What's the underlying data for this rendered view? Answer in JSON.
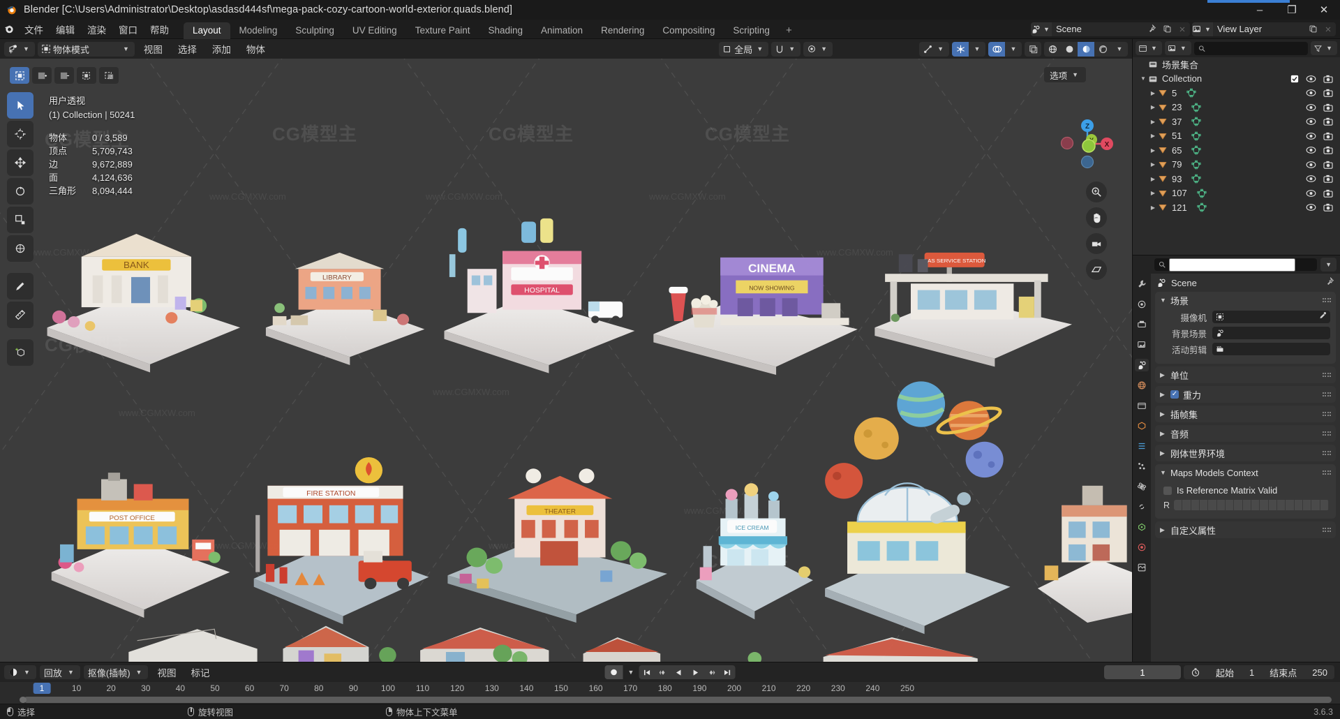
{
  "titlebar": {
    "title": "Blender [C:\\Users\\Administrator\\Desktop\\asdasd444sf\\mega-pack-cozy-cartoon-world-exterior.quads.blend]",
    "minimize": "–",
    "maximize": "❐",
    "close": "✕"
  },
  "topbar": {
    "menus": [
      "文件",
      "编辑",
      "渲染",
      "窗口",
      "帮助"
    ],
    "workspaces": [
      "Layout",
      "Modeling",
      "Sculpting",
      "UV Editing",
      "Texture Paint",
      "Shading",
      "Animation",
      "Rendering",
      "Compositing",
      "Scripting"
    ],
    "active_workspace": "Layout",
    "add_workspace": "+",
    "scene_name": "Scene",
    "view_layer_name": "View Layer"
  },
  "viewport": {
    "mode": "物体模式",
    "menus": [
      "视图",
      "选择",
      "添加",
      "物体"
    ],
    "transform_orientation": "全局",
    "options_label": "选项",
    "stats": {
      "view_name": "用户透视",
      "collection_line": "(1) Collection | 50241",
      "rows": [
        {
          "key": "物体",
          "value": "0 / 3,589"
        },
        {
          "key": "顶点",
          "value": "5,709,743"
        },
        {
          "key": "边",
          "value": "9,672,889"
        },
        {
          "key": "面",
          "value": "4,124,636"
        },
        {
          "key": "三角形",
          "value": "8,094,444"
        }
      ]
    },
    "gizmo_axes": [
      "Z",
      "Y",
      "X"
    ],
    "watermark_text": "www.CGMXW.com",
    "watermark_logo": "CG模型主"
  },
  "outliner": {
    "display_mode_icon": "view-layer-icon",
    "filter_icon": "filter-icon",
    "search_placeholder": "",
    "scene_collection_label": "场景集合",
    "collection_label": "Collection",
    "items": [
      {
        "name": "5"
      },
      {
        "name": "23"
      },
      {
        "name": "37"
      },
      {
        "name": "51"
      },
      {
        "name": "65"
      },
      {
        "name": "79"
      },
      {
        "name": "93"
      },
      {
        "name": "107"
      },
      {
        "name": "121"
      }
    ]
  },
  "properties": {
    "breadcrumb": "Scene",
    "search_placeholder": "",
    "tabs": [
      "tool-icon",
      "render-icon",
      "output-icon",
      "view-layer-icon",
      "scene-icon",
      "world-icon",
      "collection-icon",
      "object-icon",
      "modifier-icon",
      "particles-icon",
      "physics-icon",
      "constraint-icon",
      "data-icon",
      "material-icon",
      "texture-icon"
    ],
    "active_tab_index": 4,
    "panels": [
      {
        "label": "场景",
        "open": true,
        "rows": [
          {
            "label": "摄像机",
            "value": "",
            "icon": "camera-icon",
            "eyedropper": true
          },
          {
            "label": "背景场景",
            "value": "",
            "icon": "scene-icon",
            "eyedropper": false
          },
          {
            "label": "活动剪辑",
            "value": "",
            "icon": "clip-icon",
            "eyedropper": false
          }
        ]
      },
      {
        "label": "单位",
        "open": false,
        "rows": []
      },
      {
        "label": "重力",
        "open": false,
        "checkbox": true,
        "checked": true,
        "rows": []
      },
      {
        "label": "插帧集",
        "open": false,
        "rows": []
      },
      {
        "label": "音频",
        "open": false,
        "rows": []
      },
      {
        "label": "刚体世界环境",
        "open": false,
        "rows": []
      },
      {
        "label": "Maps Models Context",
        "open": true,
        "checkbox_row": {
          "label": "Is Reference Matrix Valid",
          "checked": false
        },
        "matrix_row_label": "R",
        "rows": []
      },
      {
        "label": "自定义属性",
        "open": false,
        "rows": []
      }
    ]
  },
  "timeline": {
    "editor_icon": "timeline-icon",
    "playback_label": "回放",
    "keying_label": "抠像(插帧)",
    "menus": [
      "视图",
      "标记"
    ],
    "current_frame": "1",
    "start_label": "起始",
    "start_value": "1",
    "end_label": "结束点",
    "end_value": "250",
    "ticks": [
      "10",
      "20",
      "30",
      "40",
      "50",
      "60",
      "70",
      "80",
      "90",
      "100",
      "110",
      "120",
      "130",
      "140",
      "150",
      "160",
      "170",
      "180",
      "190",
      "200",
      "210",
      "220",
      "230",
      "240",
      "250"
    ],
    "playhead_label": "1",
    "transport": [
      "jump-start-icon",
      "prev-keyframe-icon",
      "play-reverse-icon",
      "play-icon",
      "next-keyframe-icon",
      "jump-end-icon"
    ]
  },
  "statusbar": {
    "items": [
      {
        "mouse": "left",
        "label": "选择"
      },
      {
        "mouse": "middle",
        "label": "旋转视图"
      },
      {
        "mouse": "right",
        "label": "物体上下文菜单"
      }
    ],
    "version": "3.6.3"
  },
  "colors": {
    "accent": "#4772b3",
    "bg": "#1d1d1d",
    "viewport_bg": "#3c3c3c",
    "panel": "#303030"
  }
}
